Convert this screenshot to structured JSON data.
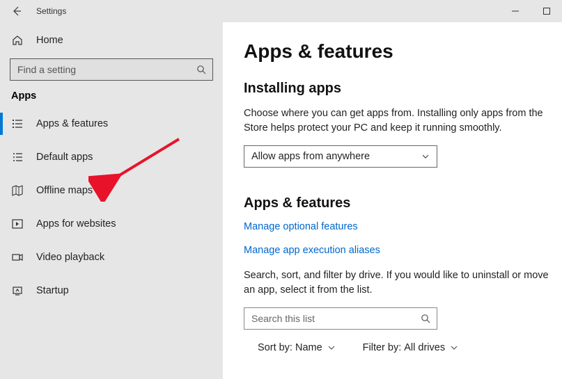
{
  "titlebar": {
    "title": "Settings"
  },
  "sidebar": {
    "home_label": "Home",
    "search_placeholder": "Find a setting",
    "section_label": "Apps",
    "items": [
      {
        "label": "Apps & features"
      },
      {
        "label": "Default apps"
      },
      {
        "label": "Offline maps"
      },
      {
        "label": "Apps for websites"
      },
      {
        "label": "Video playback"
      },
      {
        "label": "Startup"
      }
    ]
  },
  "content": {
    "page_title": "Apps & features",
    "installing_heading": "Installing apps",
    "installing_text": "Choose where you can get apps from. Installing only apps from the Store helps protect your PC and keep it running smoothly.",
    "combo_value": "Allow apps from anywhere",
    "section_heading": "Apps & features",
    "link_optional": "Manage optional features",
    "link_aliases": "Manage app execution aliases",
    "filter_text": "Search, sort, and filter by drive. If you would like to uninstall or move an app, select it from the list.",
    "list_search_placeholder": "Search this list",
    "sort_label": "Sort by:",
    "sort_value": "Name",
    "filter_label": "Filter by:",
    "filter_value": "All drives"
  }
}
